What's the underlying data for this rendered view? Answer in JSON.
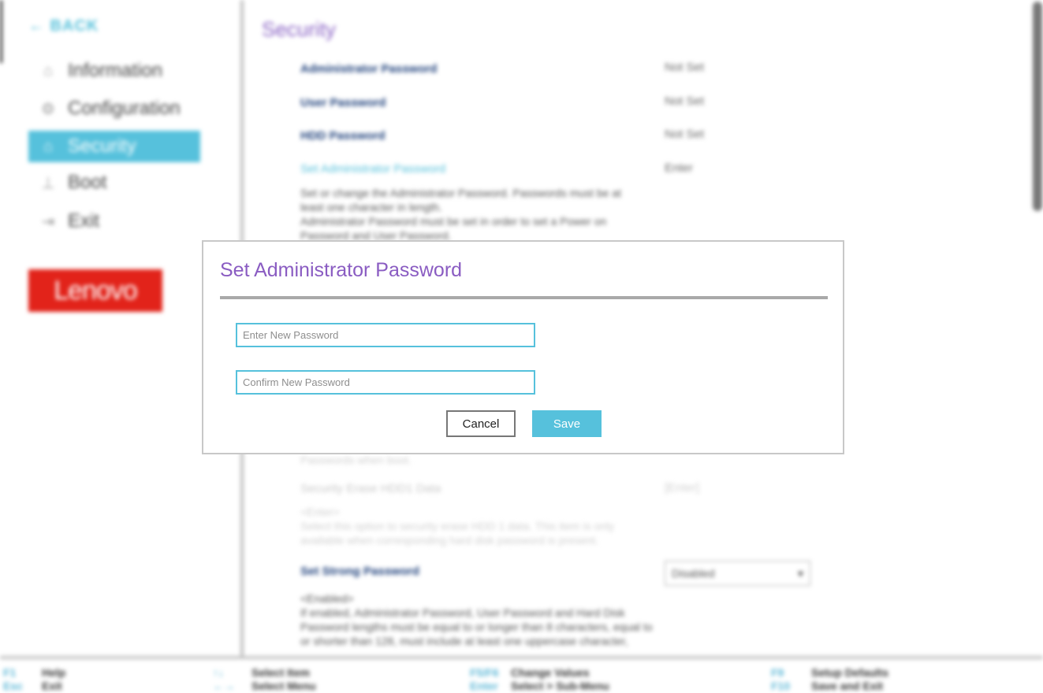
{
  "nav": {
    "back_label": "← BACK",
    "items": [
      {
        "label": "Information",
        "icon": "info-icon"
      },
      {
        "label": "Configuration",
        "icon": "settings-icon"
      },
      {
        "label": "Security",
        "icon": "lock-icon"
      },
      {
        "label": "Boot",
        "icon": "boot-icon"
      },
      {
        "label": "Exit",
        "icon": "exit-icon"
      }
    ],
    "active": "Security",
    "logo_text": "Lenovo"
  },
  "main": {
    "title": "Security",
    "rows": [
      {
        "label": "Administrator Password",
        "value": "Not Set"
      },
      {
        "label": "User Password",
        "value": "Not Set"
      },
      {
        "label": "HDD Password",
        "value": "Not Set"
      },
      {
        "label": "Set Administrator Password",
        "value": "Enter"
      }
    ],
    "set_admin_desc_1": "Set or change the Administrator Password. Passwords must be at least one character in length.",
    "set_admin_desc_2": "Administrator Password must be set in order to set a Power on Password and User Password.",
    "partial_desc": "Passwords when boot.",
    "erase_label": "Security Erase HDD1 Data",
    "erase_value": "[Enter]",
    "erase_desc_1": "<Enter>",
    "erase_desc_2": "Select this option to security erase HDD 1 data. This item is only available when corresponding hard disk password is present.",
    "strong_label": "Set Strong Password",
    "strong_value": "Disabled",
    "strong_desc_1": "<Enabled>",
    "strong_desc_2": "If enabled, Administrator Password, User Password and Hard Disk Password lengths must be equal to or longer than 8 characters, equal to or shorter than 128, must include at least one uppercase character,"
  },
  "footer": [
    {
      "key": "F1",
      "action": "Help"
    },
    {
      "key": "Esc",
      "action": "Exit"
    },
    {
      "key": "↑↓",
      "action": "Select Item"
    },
    {
      "key": "←→",
      "action": "Select Menu"
    },
    {
      "key": "F5/F6",
      "action": "Change Values"
    },
    {
      "key": "Enter",
      "action": "Select > Sub-Menu"
    },
    {
      "key": "F9",
      "action": "Setup Defaults"
    },
    {
      "key": "F10",
      "action": "Save and Exit"
    }
  ],
  "modal": {
    "title": "Set Administrator Password",
    "new_password_placeholder": "Enter New Password",
    "confirm_password_placeholder": "Confirm New Password",
    "cancel_label": "Cancel",
    "save_label": "Save"
  },
  "colors": {
    "accent": "#56c1dc",
    "title_purple": "#8a5cc2",
    "brand_red": "#e2231a"
  }
}
